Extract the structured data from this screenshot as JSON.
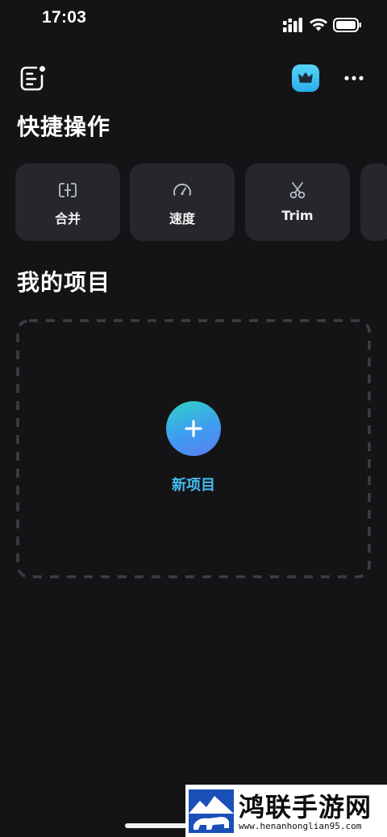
{
  "status_bar": {
    "time": "17:03"
  },
  "header": {
    "menu_icon": "menu-notification-icon",
    "pro_icon": "crown-icon",
    "more_icon": "more-horizontal-icon"
  },
  "quick_actions": {
    "title": "快捷操作",
    "items": [
      {
        "label": "合并",
        "icon": "merge-icon"
      },
      {
        "label": "速度",
        "icon": "speed-gauge-icon"
      },
      {
        "label": "Trim",
        "icon": "scissors-icon"
      }
    ]
  },
  "projects": {
    "title": "我的项目",
    "new_project_label": "新项目",
    "new_project_icon": "plus-icon"
  },
  "watermark": {
    "title": "鸿联手游网",
    "url": "www.henanhonglian95.com"
  },
  "colors": {
    "background": "#141416",
    "card": "#26272c",
    "accent": "#44bdf0",
    "pro_badge": "#2aaee8"
  }
}
